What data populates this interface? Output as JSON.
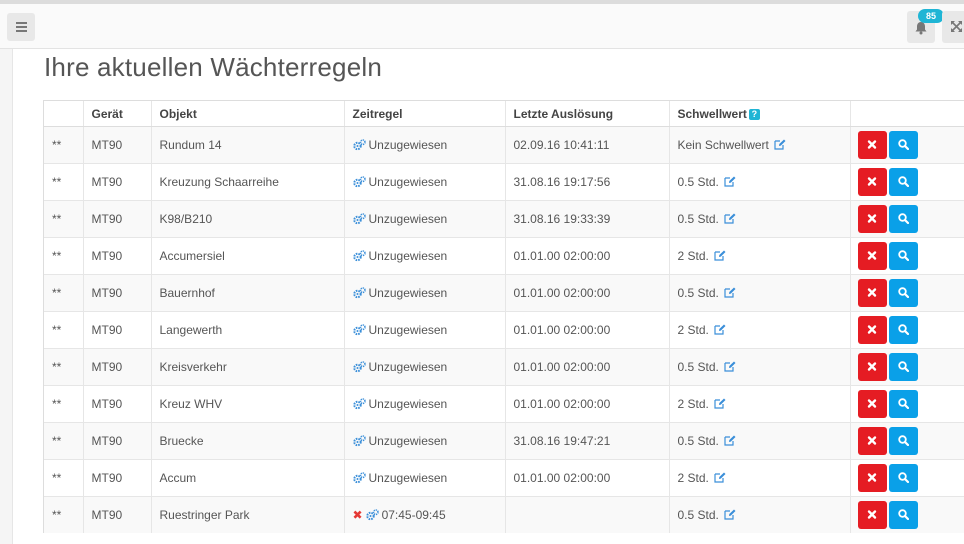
{
  "header": {
    "notifications_count": "85"
  },
  "page": {
    "title": "Ihre aktuellen Wächterregeln"
  },
  "table": {
    "columns": {
      "status": "",
      "device": "Gerät",
      "object": "Objekt",
      "schedule": "Zeitregel",
      "last_trigger": "Letzte Auslösung",
      "threshold": "Schwellwert",
      "threshold_help": "?",
      "actions": ""
    },
    "rows": [
      {
        "status": "**",
        "device": "MT90",
        "object": "Rundum 14",
        "schedule": "Unzugewiesen",
        "schedule_removable": false,
        "last_trigger": "02.09.16 10:41:11",
        "threshold": "Kein Schwellwert"
      },
      {
        "status": "**",
        "device": "MT90",
        "object": "Kreuzung Schaarreihe",
        "schedule": "Unzugewiesen",
        "schedule_removable": false,
        "last_trigger": "31.08.16 19:17:56",
        "threshold": "0.5 Std."
      },
      {
        "status": "**",
        "device": "MT90",
        "object": "K98/B210",
        "schedule": "Unzugewiesen",
        "schedule_removable": false,
        "last_trigger": "31.08.16 19:33:39",
        "threshold": "0.5 Std."
      },
      {
        "status": "**",
        "device": "MT90",
        "object": "Accumersiel",
        "schedule": "Unzugewiesen",
        "schedule_removable": false,
        "last_trigger": "01.01.00 02:00:00",
        "threshold": "2 Std."
      },
      {
        "status": "**",
        "device": "MT90",
        "object": "Bauernhof",
        "schedule": "Unzugewiesen",
        "schedule_removable": false,
        "last_trigger": "01.01.00 02:00:00",
        "threshold": "0.5 Std."
      },
      {
        "status": "**",
        "device": "MT90",
        "object": "Langewerth",
        "schedule": "Unzugewiesen",
        "schedule_removable": false,
        "last_trigger": "01.01.00 02:00:00",
        "threshold": "2 Std."
      },
      {
        "status": "**",
        "device": "MT90",
        "object": "Kreisverkehr",
        "schedule": "Unzugewiesen",
        "schedule_removable": false,
        "last_trigger": "01.01.00 02:00:00",
        "threshold": "0.5 Std."
      },
      {
        "status": "**",
        "device": "MT90",
        "object": "Kreuz WHV",
        "schedule": "Unzugewiesen",
        "schedule_removable": false,
        "last_trigger": "01.01.00 02:00:00",
        "threshold": "2 Std."
      },
      {
        "status": "**",
        "device": "MT90",
        "object": "Bruecke",
        "schedule": "Unzugewiesen",
        "schedule_removable": false,
        "last_trigger": "31.08.16 19:47:21",
        "threshold": "0.5 Std."
      },
      {
        "status": "**",
        "device": "MT90",
        "object": "Accum",
        "schedule": "Unzugewiesen",
        "schedule_removable": false,
        "last_trigger": "01.01.00 02:00:00",
        "threshold": "2 Std."
      },
      {
        "status": "**",
        "device": "MT90",
        "object": "Ruestringer Park",
        "schedule": "07:45-09:45",
        "schedule_removable": true,
        "last_trigger": "",
        "threshold": "0.5 Std."
      }
    ]
  },
  "icons": {
    "menu": "hamburger-icon",
    "notifications": "bell-icon",
    "fullscreen": "expand-icon",
    "schedule": "gears-icon",
    "edit": "edit-icon",
    "delete": "times-icon",
    "view": "search-icon",
    "remove_schedule": "close-icon"
  },
  "colors": {
    "badge": "#1fb5d5",
    "delete_button": "#e51c23",
    "view_button": "#0aa0e8",
    "link_icon": "#3b8fd9"
  }
}
